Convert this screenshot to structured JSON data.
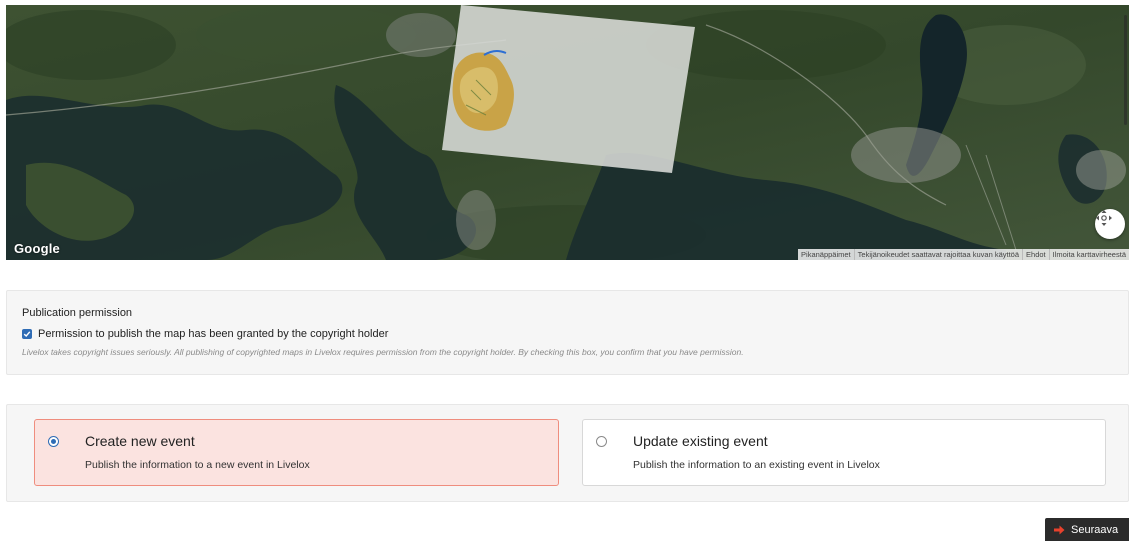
{
  "map": {
    "provider_label": "Google",
    "attribution": [
      "Pikanäppäimet",
      "Tekijänoikeudet saattavat rajoittaa kuvan käyttöä",
      "Ehdot",
      "Ilmoita karttavirheestä"
    ],
    "control_icon": "move-arrows-icon"
  },
  "permission": {
    "title": "Publication permission",
    "checkbox_label": "Permission to publish the map has been granted by the copyright holder",
    "checked": true,
    "note": "Livelox takes copyright issues seriously. All publishing of copyrighted maps in Livelox requires permission from the copyright holder. By checking this box, you confirm that you have permission."
  },
  "events": {
    "options": [
      {
        "title": "Create new event",
        "description": "Publish the information to a new event in Livelox",
        "selected": true
      },
      {
        "title": "Update existing event",
        "description": "Publish the information to an existing event in Livelox",
        "selected": false
      }
    ]
  },
  "footer": {
    "next_label": "Seuraava",
    "next_icon": "arrow-right-icon"
  },
  "colors": {
    "accent": "#2f6cb5",
    "selected_bg": "#fbe3e0",
    "selected_border": "#ef8d7e",
    "next_arrow": "#e8412c",
    "next_bg": "#2b2b2b"
  }
}
